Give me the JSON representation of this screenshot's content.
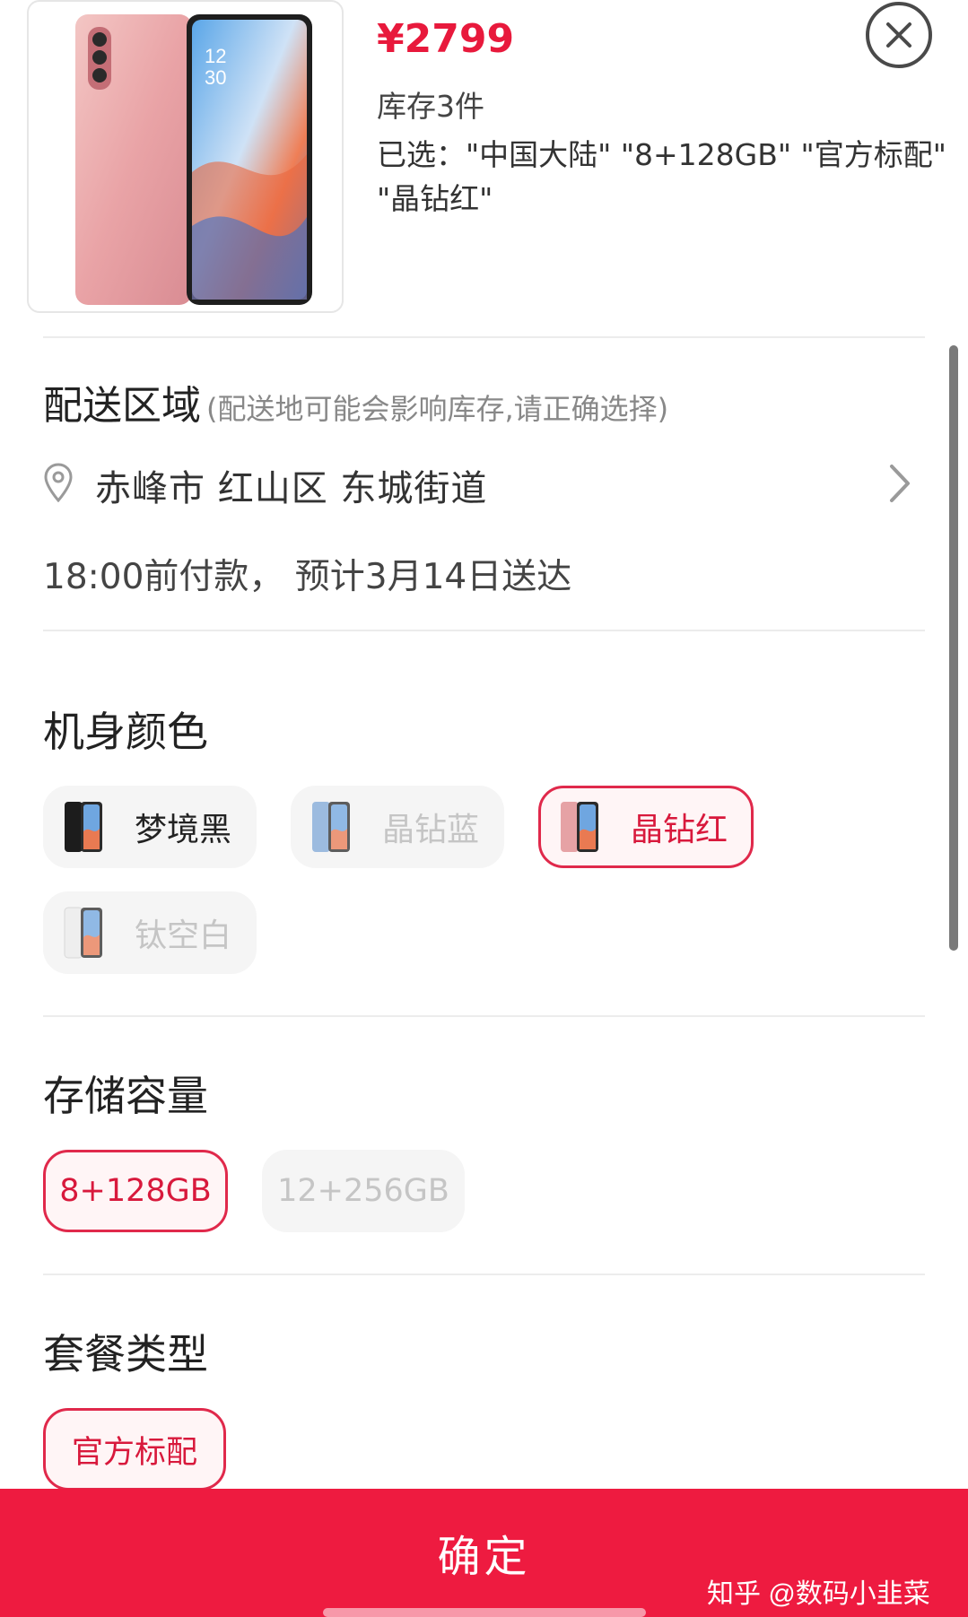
{
  "product": {
    "price": "¥2799",
    "stock": "库存3件",
    "selected_line1": "已选：\"中国大陆\" \"8+128GB\" \"官方标配\"",
    "selected_line2": "\"晶钻红\""
  },
  "delivery": {
    "title": "配送区域",
    "hint": "(配送地可能会影响库存,请正确选择)",
    "location": "赤峰市 红山区 东城街道",
    "eta": "18:00前付款， 预计3月14日送达"
  },
  "color_section": {
    "title": "机身颜色",
    "options": [
      {
        "label": "梦境黑",
        "state": "available"
      },
      {
        "label": "晶钻蓝",
        "state": "disabled"
      },
      {
        "label": "晶钻红",
        "state": "selected"
      },
      {
        "label": "钛空白",
        "state": "disabled"
      }
    ]
  },
  "storage_section": {
    "title": "存储容量",
    "options": [
      {
        "label": "8+128GB",
        "state": "selected"
      },
      {
        "label": "12+256GB",
        "state": "disabled"
      }
    ]
  },
  "package_section": {
    "title": "套餐类型",
    "options": [
      {
        "label": "官方标配",
        "state": "selected"
      }
    ]
  },
  "footer": {
    "confirm_label": "确定",
    "watermark": "知乎 @数码小韭菜"
  },
  "colors": {
    "accent": "#ee1b40",
    "price": "#e8193c"
  }
}
